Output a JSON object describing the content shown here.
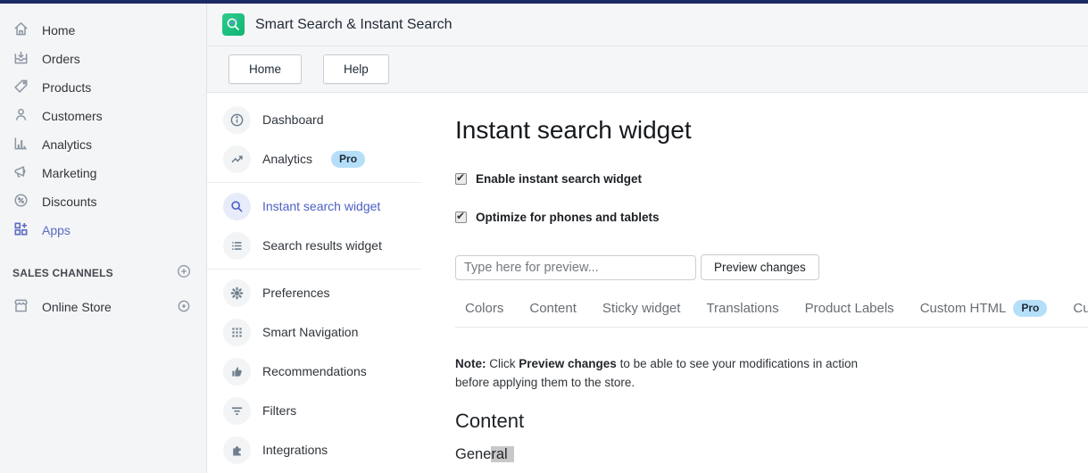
{
  "colors": {
    "topbar": "#1c2a63",
    "accent_indigo": "#5c6ac4",
    "active_link": "#4c5fc4",
    "app_icon_green": "#14b877",
    "pro_badge_bg": "#b5dff8",
    "selection_highlight": "#c8c8c8"
  },
  "shopify_nav": {
    "items": [
      {
        "label": "Home",
        "icon": "home-icon"
      },
      {
        "label": "Orders",
        "icon": "orders-icon"
      },
      {
        "label": "Products",
        "icon": "tag-icon"
      },
      {
        "label": "Customers",
        "icon": "customers-icon"
      },
      {
        "label": "Analytics",
        "icon": "analytics-icon"
      },
      {
        "label": "Marketing",
        "icon": "megaphone-icon"
      },
      {
        "label": "Discounts",
        "icon": "discount-icon"
      },
      {
        "label": "Apps",
        "icon": "apps-icon",
        "active": true
      }
    ],
    "sales_channels_label": "SALES CHANNELS",
    "online_store_label": "Online Store"
  },
  "app_header": {
    "title": "Smart Search & Instant Search",
    "home_button": "Home",
    "help_button": "Help"
  },
  "app_sidebar": {
    "sections": [
      {
        "items": [
          {
            "label": "Dashboard",
            "icon": "info-icon"
          },
          {
            "label": "Analytics",
            "icon": "trend-icon",
            "badge": "Pro"
          }
        ]
      },
      {
        "items": [
          {
            "label": "Instant search widget",
            "icon": "search-icon",
            "active": true
          },
          {
            "label": "Search results widget",
            "icon": "list-icon"
          }
        ]
      },
      {
        "items": [
          {
            "label": "Preferences",
            "icon": "gear-icon"
          },
          {
            "label": "Smart Navigation",
            "icon": "grid-icon"
          },
          {
            "label": "Recommendations",
            "icon": "thumbs-up-icon"
          },
          {
            "label": "Filters",
            "icon": "filter-icon"
          },
          {
            "label": "Integrations",
            "icon": "puzzle-icon"
          }
        ]
      }
    ]
  },
  "main": {
    "title": "Instant search widget",
    "checkboxes": [
      {
        "label": "Enable instant search widget",
        "checked": true
      },
      {
        "label": "Optimize for phones and tablets",
        "checked": true
      }
    ],
    "preview": {
      "placeholder": "Type here for preview...",
      "button": "Preview changes"
    },
    "tabs": [
      {
        "label": "Colors"
      },
      {
        "label": "Content"
      },
      {
        "label": "Sticky widget"
      },
      {
        "label": "Translations"
      },
      {
        "label": "Product Labels"
      },
      {
        "label": "Custom HTML",
        "badge": "Pro"
      },
      {
        "label": "Custom"
      }
    ],
    "note": {
      "prefix": "Note:",
      "mid": " Click ",
      "bold": "Preview changes",
      "suffix": " to be able to see your modifications in action before applying them to the store."
    },
    "content_heading": "Content",
    "general": {
      "normal": "Gene",
      "selected": "ral"
    }
  }
}
